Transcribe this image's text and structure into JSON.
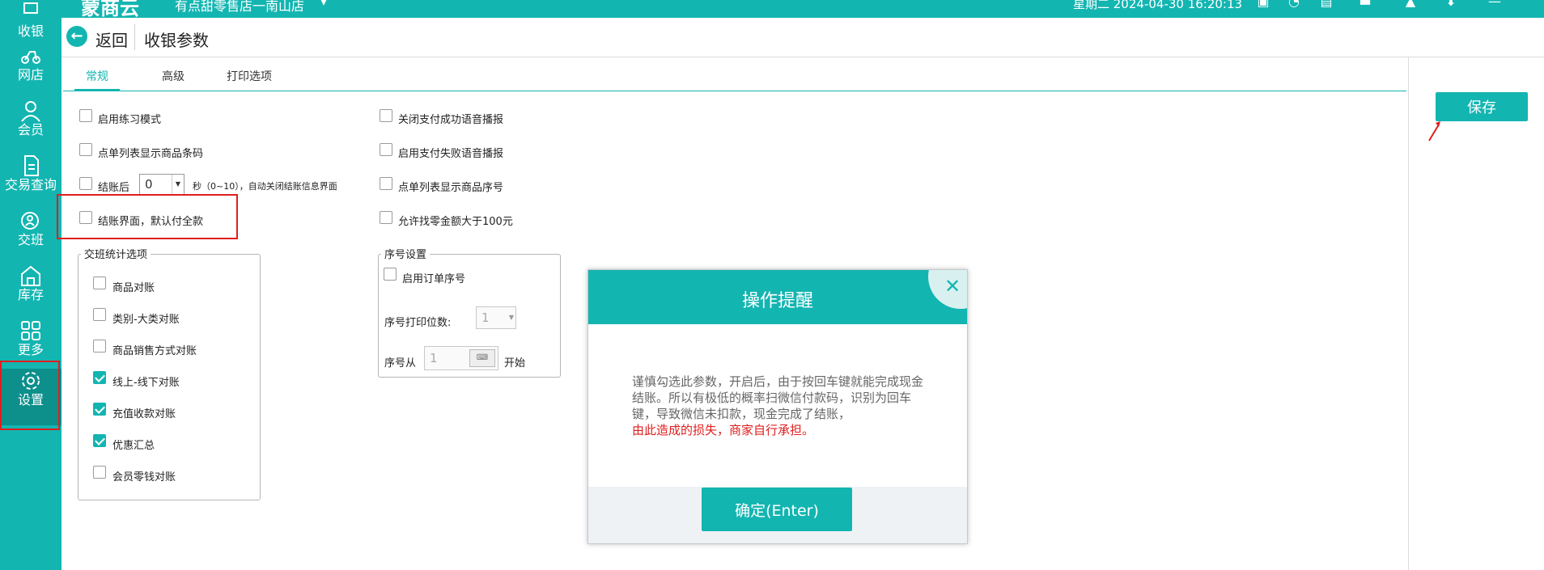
{
  "topbar": {
    "logo": "蒙商云",
    "store": "有点甜零售店一南山店",
    "datetime": "星期二 2024-04-30 16:20:13",
    "icons": [
      "screen-icon",
      "wifi-icon",
      "printer-icon",
      "message-icon",
      "shirt-icon",
      "download-icon",
      "minimize-icon"
    ]
  },
  "sidebar": {
    "items": [
      {
        "label": "收银",
        "icon": "cashier-icon"
      },
      {
        "label": "网店",
        "icon": "scooter-icon"
      },
      {
        "label": "会员",
        "icon": "user-icon"
      },
      {
        "label": "交易查询",
        "icon": "document-icon"
      },
      {
        "label": "交班",
        "icon": "handover-icon"
      },
      {
        "label": "库存",
        "icon": "warehouse-icon"
      },
      {
        "label": "更多",
        "icon": "grid-icon"
      },
      {
        "label": "设置",
        "icon": "gear-icon"
      }
    ]
  },
  "header": {
    "back_label": "返回",
    "title": "收银参数"
  },
  "tabs": [
    {
      "label": "常规",
      "active": true
    },
    {
      "label": "高级",
      "active": false
    },
    {
      "label": "打印选项",
      "active": false
    }
  ],
  "save_label": "保存",
  "left_options": [
    {
      "label": "启用练习模式",
      "checked": false
    },
    {
      "label": "点单列表显示商品条码",
      "checked": false
    },
    {
      "label": "结账后",
      "checked": false
    },
    {
      "label": "结账界面，默认付全款",
      "checked": false
    }
  ],
  "checkout_seconds": {
    "value": "0",
    "suffix": "秒（0~10），自动关闭结账信息界面"
  },
  "right_options": [
    {
      "label": "关闭支付成功语音播报",
      "checked": false
    },
    {
      "label": "启用支付失败语音播报",
      "checked": false
    },
    {
      "label": "点单列表显示商品序号",
      "checked": false
    },
    {
      "label": "允许找零金额大于100元",
      "checked": false
    }
  ],
  "shift_group": {
    "title": "交班统计选项",
    "items": [
      {
        "label": "商品对账",
        "checked": false
      },
      {
        "label": "类别-大类对账",
        "checked": false
      },
      {
        "label": "商品销售方式对账",
        "checked": false
      },
      {
        "label": "线上-线下对账",
        "checked": true
      },
      {
        "label": "充值收款对账",
        "checked": true
      },
      {
        "label": "优惠汇总",
        "checked": true
      },
      {
        "label": "会员零钱对账",
        "checked": false
      }
    ]
  },
  "serial_group": {
    "title": "序号设置",
    "enable_label": "启用订单序号",
    "enable_checked": false,
    "digits_label": "序号打印位数:",
    "digits_value": "1",
    "from_label": "序号从",
    "from_value": "1",
    "start_label": "开始"
  },
  "modal": {
    "title": "操作提醒",
    "body": "谨慎勾选此参数，开启后，由于按回车键就能完成现金结账。所以有极低的概率扫微信付款码，识别为回车键，导致微信未扣款，现金完成了结账，",
    "warning": "由此造成的损失，商家自行承担。",
    "confirm_label": "确定(Enter)",
    "close_icon": "close-icon"
  },
  "colors": {
    "accent": "#13b5b1",
    "highlight": "#e01e1e"
  }
}
